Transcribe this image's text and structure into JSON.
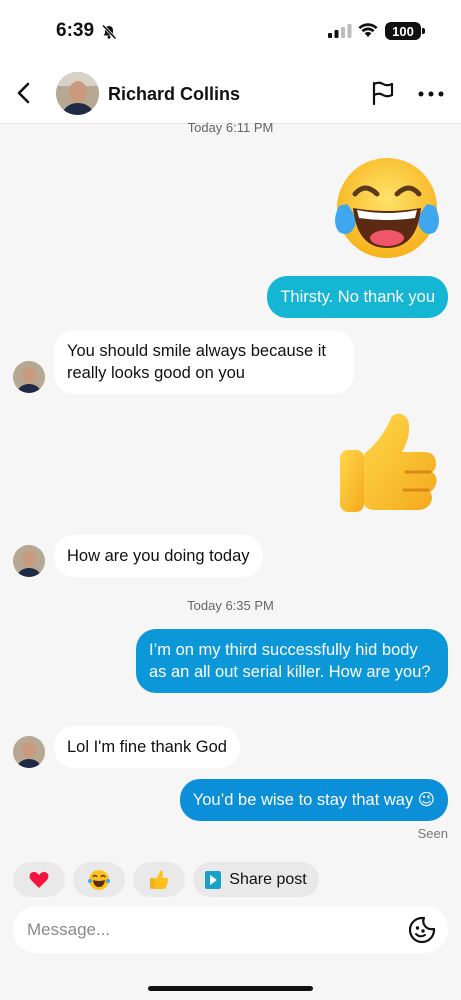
{
  "status_bar": {
    "time": "6:39",
    "battery": "100"
  },
  "header": {
    "contact_name": "Richard Collins"
  },
  "timestamps": {
    "first": "Today 6:11 PM",
    "second": "Today 6:35 PM"
  },
  "messages": [
    {
      "direction": "out",
      "type": "emoji",
      "emoji": "face-with-tears-of-joy"
    },
    {
      "direction": "out",
      "type": "text",
      "text": "Thirsty. No thank you"
    },
    {
      "direction": "in",
      "type": "text",
      "text": "You should smile always because it really looks good on you"
    },
    {
      "direction": "out",
      "type": "emoji",
      "emoji": "thumbs-up"
    },
    {
      "direction": "in",
      "type": "text",
      "text": "How are you doing today"
    },
    {
      "direction": "out",
      "type": "text",
      "text": "I’m on my third successfully hid body as an all out serial killer. How are you?"
    },
    {
      "direction": "in",
      "type": "text",
      "text": "Lol I'm fine thank God"
    },
    {
      "direction": "out",
      "type": "text",
      "text": "You’d be wise to stay that way 😉"
    }
  ],
  "seen_label": "Seen",
  "quick_replies": {
    "share_label": "Share post",
    "emoji": [
      "heart",
      "laughing",
      "thumbs-up"
    ]
  },
  "composer": {
    "placeholder": "Message..."
  },
  "colors": {
    "outgoing_bubble_light": "#15b6d3",
    "outgoing_bubble_dark": "#0b8fd9",
    "incoming_bubble": "#ffffff",
    "background": "#f6f6f6"
  }
}
